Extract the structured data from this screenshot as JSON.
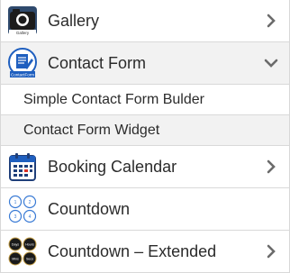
{
  "menu": {
    "items": [
      {
        "label": "Gallery",
        "icon": "camera-icon"
      },
      {
        "label": "Contact Form",
        "icon": "contact-form-icon",
        "expanded": true
      },
      {
        "label": "Booking Calendar",
        "icon": "calendar-icon"
      },
      {
        "label": "Countdown",
        "icon": "countdown-icon"
      },
      {
        "label": "Countdown – Extended",
        "icon": "countdown-extended-icon"
      }
    ],
    "subitems": [
      {
        "label": "Simple Contact Form Bulder"
      },
      {
        "label": "Contact Form Widget"
      }
    ]
  },
  "icon_text": {
    "gallery": "Gallery",
    "contact": "ContactForm",
    "countdown": [
      "1",
      "2",
      "3",
      "4"
    ],
    "extended": [
      "Days",
      "Hours",
      "Mins",
      "Secs"
    ]
  },
  "colors": {
    "chevron": "#6b6b6b",
    "divider": "#d9d9d9",
    "sub_bg": "#f2f2f2",
    "calendar_accent": "#1f5fbf",
    "countdown_blue": "#3a7bd5"
  }
}
